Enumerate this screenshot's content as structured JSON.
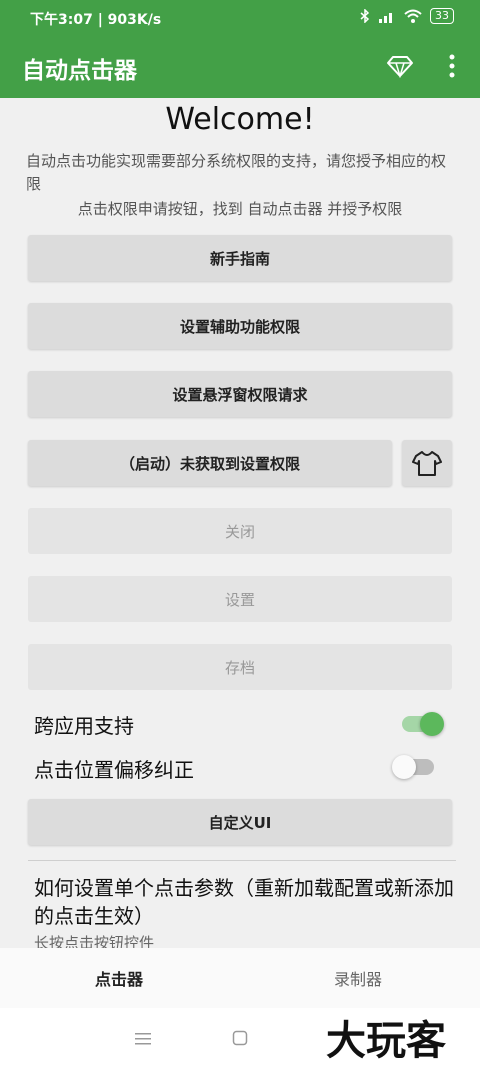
{
  "status_bar": {
    "left_text": "下午3:07 | 903K/s",
    "battery": "33"
  },
  "app_bar": {
    "title": "自动点击器",
    "icons": [
      "diamond-icon",
      "more-vert-icon"
    ]
  },
  "welcome": {
    "title": "Welcome!",
    "desc1": "自动点击功能实现需要部分系统权限的支持，请您授予相应的权限",
    "desc2": "点击权限申请按钮，找到 自动点击器 并授予权限"
  },
  "buttons": {
    "guide": "新手指南",
    "accessibility": "设置辅助功能权限",
    "overlay": "设置悬浮窗权限请求",
    "start": "（启动）未获取到设置权限",
    "close": "关闭",
    "settings": "设置",
    "archive": "存档",
    "custom_ui": "自定义UI"
  },
  "toggles": {
    "cross_app": {
      "label": "跨应用支持",
      "on": true
    },
    "offset": {
      "label": "点击位置偏移纠正",
      "on": false
    }
  },
  "howto": {
    "title": "如何设置单个点击参数（重新加载配置或新添加的点击生效）",
    "sub": "长按点击按钮控件"
  },
  "bottom_nav": {
    "tabs": [
      "点击器",
      "录制器"
    ],
    "active": "点击器"
  },
  "watermark": "大玩客",
  "colors": {
    "primary": "#43a047",
    "switch_on": "#5cb85c"
  }
}
